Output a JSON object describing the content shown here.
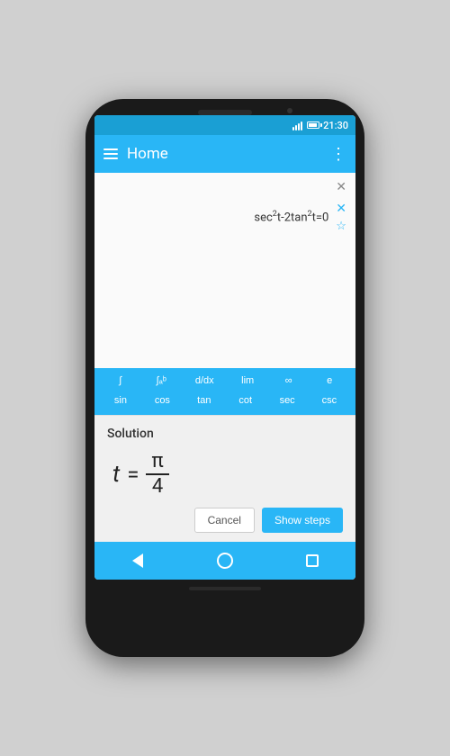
{
  "status_bar": {
    "time": "21:30"
  },
  "app_bar": {
    "title": "Home",
    "menu_label": "☰",
    "more_label": "⋮"
  },
  "equation": {
    "text": "sec²t-2tan²t=0",
    "display": "sec²t-2tan²t=0"
  },
  "keyboard": {
    "row1": [
      "∫",
      "∫ᵃᵇ",
      "d/dx",
      "lim",
      "∞",
      "e"
    ],
    "row2": [
      "sin",
      "cos",
      "tan",
      "cot",
      "sec",
      "csc"
    ]
  },
  "solution": {
    "label": "Solution",
    "variable": "t",
    "equals": "=",
    "numerator": "π",
    "denominator": "4"
  },
  "buttons": {
    "cancel": "Cancel",
    "show_steps": "Show steps"
  },
  "nav": {
    "back_title": "back",
    "home_title": "home",
    "recent_title": "recent"
  }
}
